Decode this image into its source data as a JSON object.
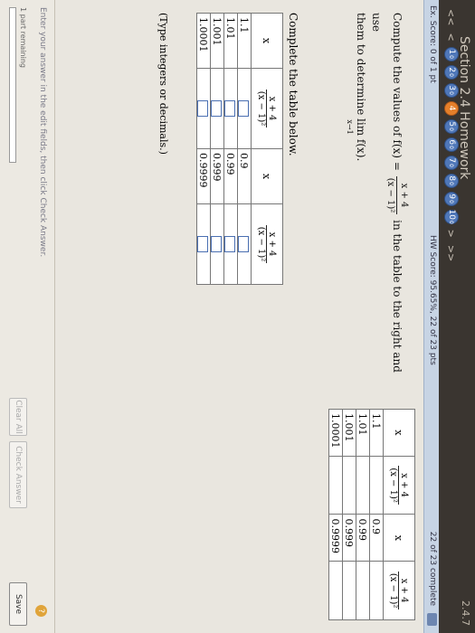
{
  "header": {
    "title": "Section 2.4 Homework",
    "corner": "2.4.7",
    "nav": {
      "prev": "<<",
      "back": "<",
      "next": ">",
      "last": ">>",
      "questions": [
        {
          "n": "1",
          "mark": "0",
          "current": false
        },
        {
          "n": "2",
          "mark": "0",
          "current": false
        },
        {
          "n": "3",
          "mark": "0",
          "current": false
        },
        {
          "n": "4",
          "mark": "",
          "current": true
        },
        {
          "n": "5",
          "mark": "0",
          "current": false
        },
        {
          "n": "6",
          "mark": "0",
          "current": false
        },
        {
          "n": "7",
          "mark": "0",
          "current": false
        },
        {
          "n": "8",
          "mark": "0",
          "current": false
        },
        {
          "n": "9",
          "mark": "0",
          "current": false
        },
        {
          "n": "10",
          "mark": "0",
          "current": false
        }
      ]
    }
  },
  "scorebar": {
    "ex_score": "Ex. Score: 0 of 1 pt",
    "hw_score": "HW Score: 95.65%, 22 of 23 pts",
    "progress": "22 of 23 complete"
  },
  "problem": {
    "prompt_start": "Compute the values of f(x) =",
    "numerator": "x + 4",
    "denominator": "(x − 1)²",
    "prompt_mid": "in the table to the right and use",
    "prompt_end": "them to determine",
    "lim_word": "lim",
    "lim_sub": "x→1",
    "lim_func": "f(x)."
  },
  "ref_table": {
    "col_x": "x",
    "col_f": "x + 4 / (x − 1)²",
    "f_num": "x + 4",
    "f_den": "(x − 1)²",
    "left_x": [
      "1.1",
      "1.01",
      "1.001",
      "1.0001"
    ],
    "right_x": [
      "0.9",
      "0.99",
      "0.999",
      "0.9999"
    ]
  },
  "answer": {
    "label": "Complete the table below.",
    "col_x": "x",
    "f_num": "x + 4",
    "f_den": "(x − 1)²",
    "left_x": [
      "1.1",
      "1.01",
      "1.001",
      "1.0001"
    ],
    "right_x": [
      "0.9",
      "0.99",
      "0.999",
      "0.9999"
    ],
    "hint": "(Type integers or decimals.)"
  },
  "footer": {
    "instruction": "Enter your answer in the edit fields, then click Check Answer.",
    "part": "1 part remaining",
    "part_progress": 0.0,
    "clear": "Clear All",
    "check": "Check Answer",
    "save": "Save",
    "help": "?"
  }
}
